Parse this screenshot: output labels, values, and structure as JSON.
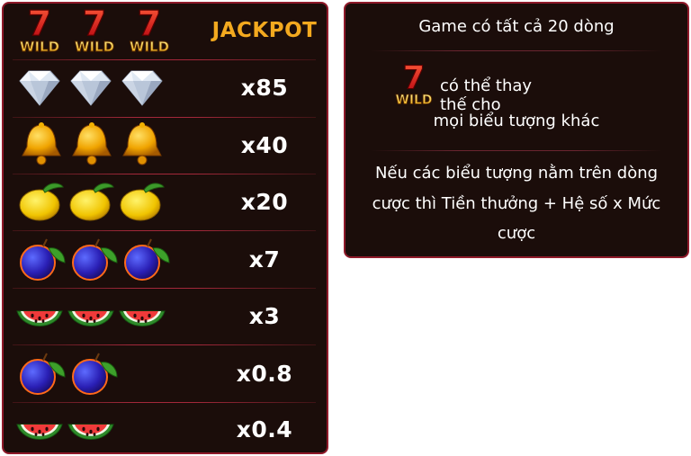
{
  "paytable": {
    "rows": [
      {
        "symbol": "wild-seven",
        "count": 3,
        "payout": "JACKPOT"
      },
      {
        "symbol": "diamond",
        "count": 3,
        "payout": "x85"
      },
      {
        "symbol": "bell",
        "count": 3,
        "payout": "x40"
      },
      {
        "symbol": "lemon",
        "count": 3,
        "payout": "x20"
      },
      {
        "symbol": "plum",
        "count": 3,
        "payout": "x7"
      },
      {
        "symbol": "watermelon",
        "count": 3,
        "payout": "x3"
      },
      {
        "symbol": "plum",
        "count": 2,
        "payout": "x0.8"
      },
      {
        "symbol": "watermelon",
        "count": 2,
        "payout": "x0.4"
      }
    ],
    "wild_label": "WILD",
    "seven_label": "7"
  },
  "info": {
    "lines_text": "Game có tất cả 20 dòng",
    "wild_text_1": "có thể thay thế cho",
    "wild_text_2": "mọi biểu tượng khác",
    "payout_text_1": "Nếu các biểu tượng nằm trên dòng",
    "payout_text_2": "cược thì Tiền thưởng + Hệ số x Mức",
    "payout_text_3": "cược"
  },
  "colors": {
    "panel_bg": "#1b0d0a",
    "panel_border": "#8f1a2a",
    "jackpot": "#f3a91f",
    "text": "#ffffff"
  }
}
